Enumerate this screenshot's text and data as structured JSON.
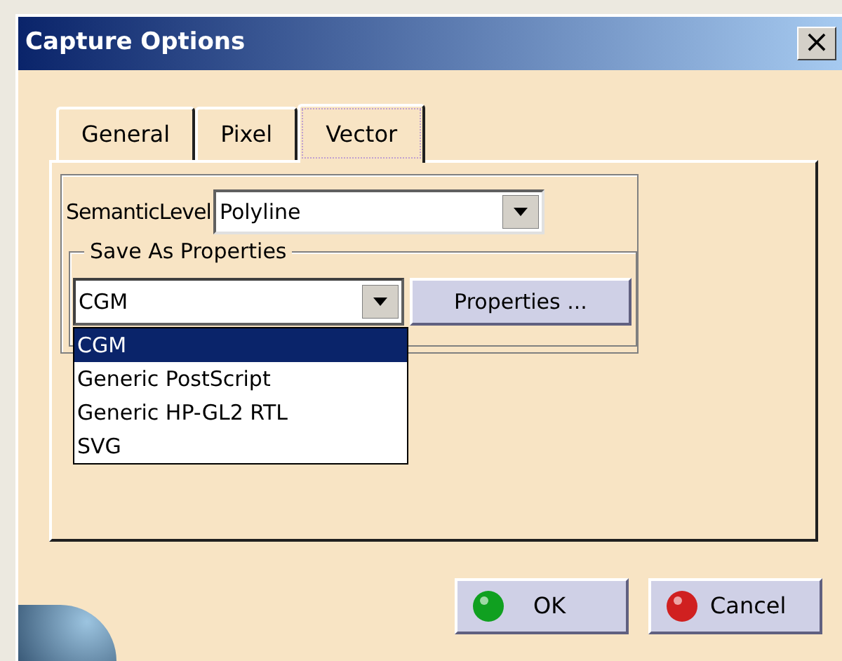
{
  "window": {
    "title": "Capture Options",
    "close": "×"
  },
  "tabs": [
    {
      "label": "General",
      "selected": false
    },
    {
      "label": "Pixel",
      "selected": false
    },
    {
      "label": "Vector",
      "selected": true
    }
  ],
  "semantic_level": {
    "label": "SemanticLevel",
    "value": "Polyline"
  },
  "save_as": {
    "title": "Save As Properties",
    "value": "CGM",
    "button": "Properties ...",
    "options": [
      {
        "label": "CGM",
        "selected": true
      },
      {
        "label": "Generic PostScript",
        "selected": false
      },
      {
        "label": "Generic HP-GL2 RTL",
        "selected": false
      },
      {
        "label": "SVG",
        "selected": false
      }
    ]
  },
  "buttons": [
    {
      "label": "OK",
      "kind": "ok"
    },
    {
      "label": "Cancel",
      "kind": "cancel"
    }
  ]
}
